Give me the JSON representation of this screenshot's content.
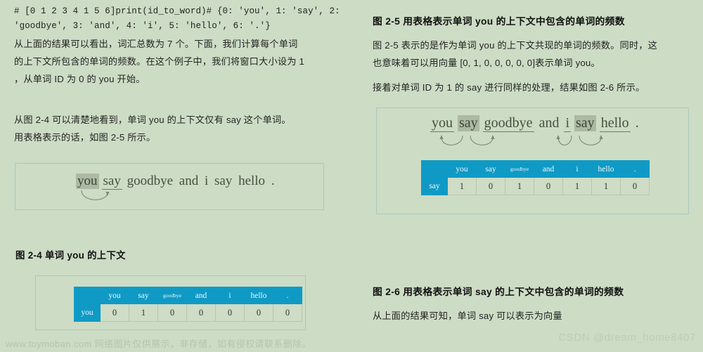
{
  "theme": {
    "page_bg": "#cddcc5",
    "table_header": "#0f9ac5",
    "table_cell": "#cfdcc6",
    "frame_border": "#a8c9c0",
    "highlight": "#adb9a2"
  },
  "left": {
    "code_line_1": "# [0 1 2 3 4 1 5 6]print(id_to_word)# {0: 'you', 1: 'say', 2:",
    "code_line_2": "'goodbye', 3: 'and', 4: 'i', 5: 'hello', 6: '.'}",
    "para_1_line_1": "从上面的结果可以看出，词汇总数为 7 个。下面，我们计算每个单词",
    "para_1_line_2": "的上下文所包含的单词的频数。在这个例子中，我们将窗口大小设为 1",
    "para_1_line_3": "，从单词 ID 为 0 的 you 开始。",
    "para_2_line_1": "从图 2-4 可以清楚地看到，单词 you 的上下文仅有 say 这个单词。",
    "para_2_line_2": "用表格表示的话，如图 2-5 所示。",
    "figure_2_4": {
      "sentence": [
        "you",
        "say",
        "goodbye",
        "and",
        "i",
        "say",
        "hello",
        "."
      ],
      "highlighted": [
        "you"
      ],
      "underlined": [
        "say"
      ]
    },
    "caption_2_4": "图 2-4   单词 you 的上下文",
    "table_2_5": {
      "corner": "",
      "columns": [
        "you",
        "say",
        "goodbye",
        "and",
        "i",
        "hello",
        "."
      ],
      "row_label": "you",
      "values": [
        "0",
        "1",
        "0",
        "0",
        "0",
        "0",
        "0"
      ]
    }
  },
  "right": {
    "caption_2_5": "图 2-5   用表格表示单词 you 的上下文中包含的单词的频数",
    "para_1_line_1": "图 2-5 表示的是作为单词 you 的上下文共现的单词的频数。同时，这",
    "para_1_line_2": "也意味着可以用向量 [0, 1, 0, 0, 0, 0, 0]表示单词 you。",
    "para_2_line_1": "接着对单词 ID 为 1 的 say 进行同样的处理，结果如图 2-6 所示。",
    "figure_2_6": {
      "sentence": [
        "you",
        "say",
        "goodbye",
        "and",
        "i",
        "say",
        "hello",
        "."
      ],
      "highlighted": [
        "say",
        "say"
      ],
      "underlined": [
        "you",
        "goodbye",
        "i",
        "hello"
      ]
    },
    "table_2_6": {
      "corner": "",
      "columns": [
        "you",
        "say",
        "goodbye",
        "and",
        "i",
        "hello",
        "."
      ],
      "row_label": "say",
      "values": [
        "1",
        "0",
        "1",
        "0",
        "1",
        "1",
        "0"
      ]
    },
    "caption_2_6": "图 2-6   用表格表示单词 say 的上下文中包含的单词的频数",
    "para_3_line_1": "从上面的结果可知，单词 say 可以表示为向量"
  },
  "watermarks": {
    "left": "www.toymoban.com 网络图片仅供展示，非存储，如有侵权请联系删除。",
    "right": "CSDN @dream_home8407"
  }
}
